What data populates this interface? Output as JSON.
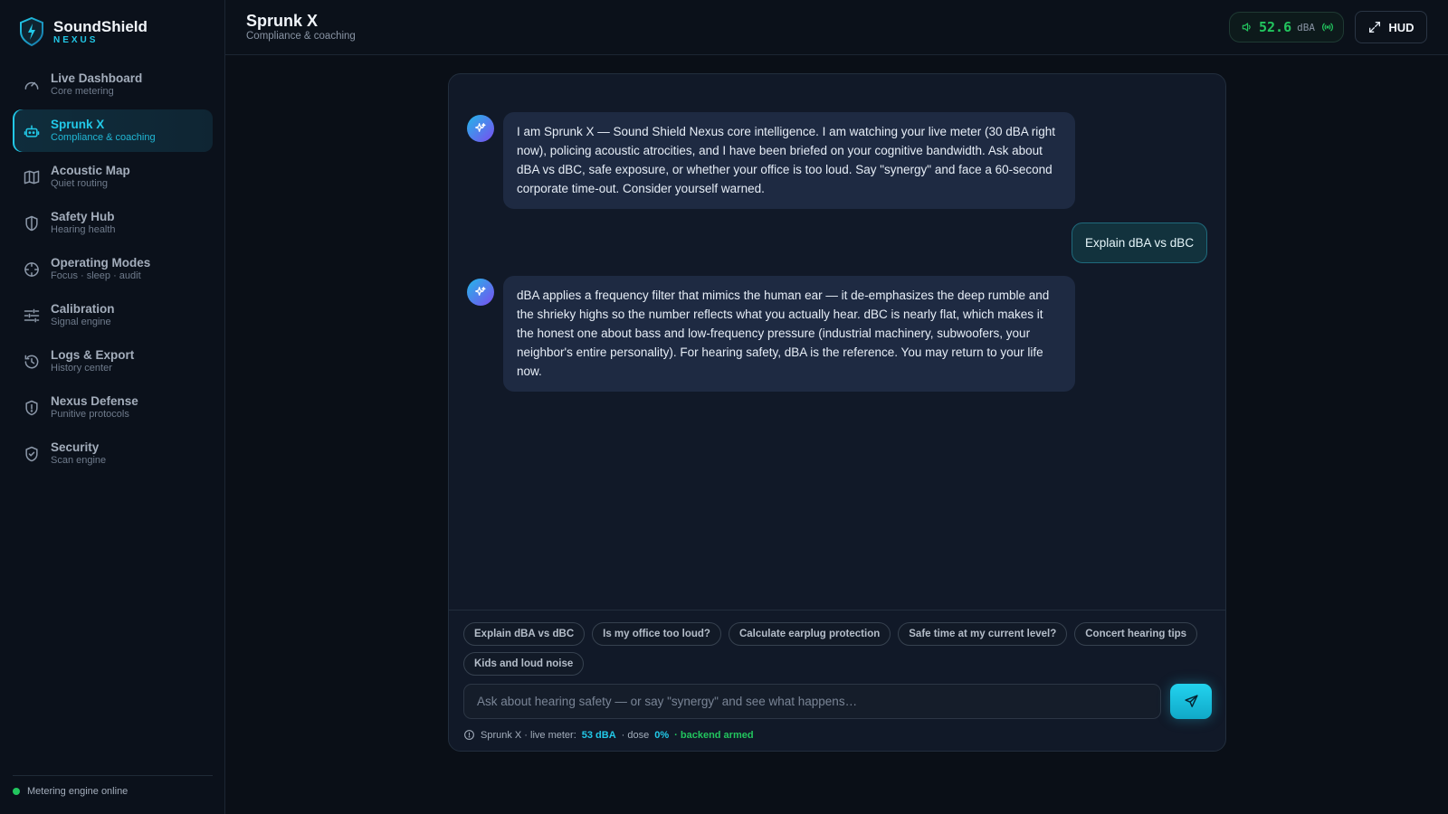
{
  "brand": {
    "title": "SoundShield",
    "subtitle": "NEXUS"
  },
  "sidebar": {
    "items": [
      {
        "label": "Live Dashboard",
        "sub": "Core metering",
        "icon": "gauge-icon"
      },
      {
        "label": "Sprunk X",
        "sub": "Compliance & coaching",
        "icon": "robot-icon",
        "active": true
      },
      {
        "label": "Acoustic Map",
        "sub": "Quiet routing",
        "icon": "map-icon"
      },
      {
        "label": "Safety Hub",
        "sub": "Hearing health",
        "icon": "shield-icon"
      },
      {
        "label": "Operating Modes",
        "sub": "Focus · sleep · audit",
        "icon": "crosshair-icon"
      },
      {
        "label": "Calibration",
        "sub": "Signal engine",
        "icon": "sliders-icon"
      },
      {
        "label": "Logs & Export",
        "sub": "History center",
        "icon": "history-icon"
      },
      {
        "label": "Nexus Defense",
        "sub": "Punitive protocols",
        "icon": "shield-alert-icon"
      },
      {
        "label": "Security",
        "sub": "Scan engine",
        "icon": "shield-check-icon"
      }
    ],
    "footer_status": "Metering engine online"
  },
  "header": {
    "title": "Sprunk X",
    "subtitle": "Compliance & coaching",
    "meter_value": "52.6",
    "meter_unit": "dBA",
    "hud_label": "HUD"
  },
  "chat": {
    "messages": [
      {
        "role": "assistant",
        "text": "I am Sprunk X — Sound Shield Nexus core intelligence. I am watching your live meter (30 dBA right now), policing acoustic atrocities, and I have been briefed on your cognitive bandwidth. Ask about dBA vs dBC, safe exposure, or whether your office is too loud. Say \"synergy\" and face a 60-second corporate time-out. Consider yourself warned."
      },
      {
        "role": "user",
        "text": "Explain dBA vs dBC"
      },
      {
        "role": "assistant",
        "text": "dBA applies a frequency filter that mimics the human ear — it de-emphasizes the deep rumble and the shrieky highs so the number reflects what you actually hear. dBC is nearly flat, which makes it the honest one about bass and low-frequency pressure (industrial machinery, subwoofers, your neighbor's entire personality). For hearing safety, dBA is the reference. You may return to your life now."
      }
    ],
    "suggestions": [
      "Explain dBA vs dBC",
      "Is my office too loud?",
      "Calculate earplug protection",
      "Safe time at my current level?",
      "Concert hearing tips",
      "Kids and loud noise"
    ],
    "input_placeholder": "Ask about hearing safety — or say \"synergy\" and see what happens…",
    "status": {
      "prefix": "Sprunk X · live meter:",
      "meter": "53 dBA",
      "dose_label": "· dose",
      "dose": "0%",
      "armed": "· backend armed"
    }
  },
  "colors": {
    "accent": "#22c9e8",
    "ok": "#22c55e",
    "bg": "#0a0f17"
  }
}
